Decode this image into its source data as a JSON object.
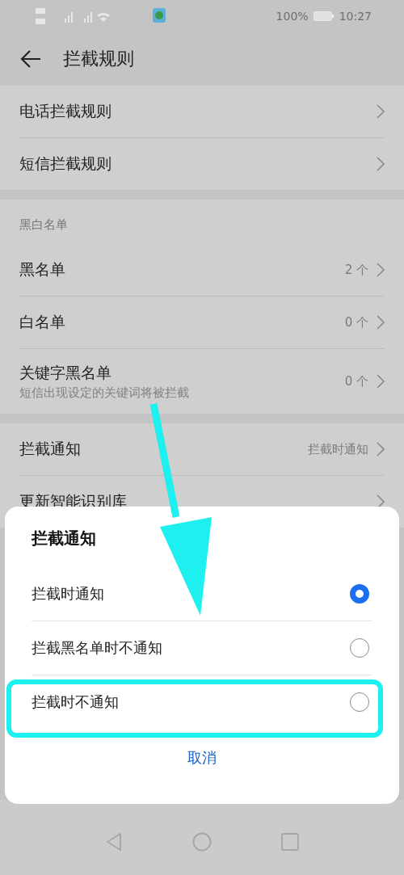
{
  "status_bar": {
    "battery": "100%",
    "time": "10:27"
  },
  "header": {
    "title": "拦截规则"
  },
  "sections": [
    {
      "items": [
        {
          "label": "电话拦截规则"
        },
        {
          "label": "短信拦截规则"
        }
      ]
    },
    {
      "heading": "黑白名单",
      "items": [
        {
          "label": "黑名单",
          "value": "2 个"
        },
        {
          "label": "白名单",
          "value": "0 个"
        },
        {
          "label": "关键字黑名单",
          "subtitle": "短信出现设定的关键词将被拦截",
          "value": "0 个"
        }
      ]
    },
    {
      "items": [
        {
          "label": "拦截通知",
          "value": "拦截时通知"
        },
        {
          "label": "更新智能识别库"
        }
      ]
    }
  ],
  "dialog": {
    "title": "拦截通知",
    "options": [
      {
        "label": "拦截时通知",
        "selected": true,
        "highlighted": false
      },
      {
        "label": "拦截黑名单时不通知",
        "selected": false,
        "highlighted": false
      },
      {
        "label": "拦截时不通知",
        "selected": false,
        "highlighted": true
      }
    ],
    "cancel": "取消"
  }
}
